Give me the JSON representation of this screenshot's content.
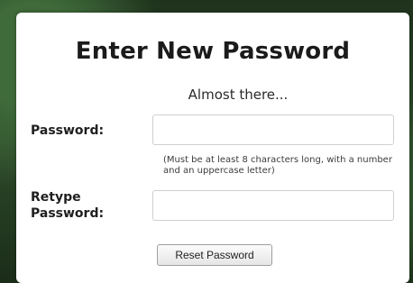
{
  "form": {
    "title": "Enter New Password",
    "subtitle": "Almost there...",
    "password_label": "Password:",
    "password_value": "",
    "password_hint": "(Must be at least 8 characters long, with a number and an uppercase letter)",
    "retype_label_line1": "Retype",
    "retype_label_line2": "Password:",
    "retype_value": "",
    "submit_label": "Reset Password"
  }
}
